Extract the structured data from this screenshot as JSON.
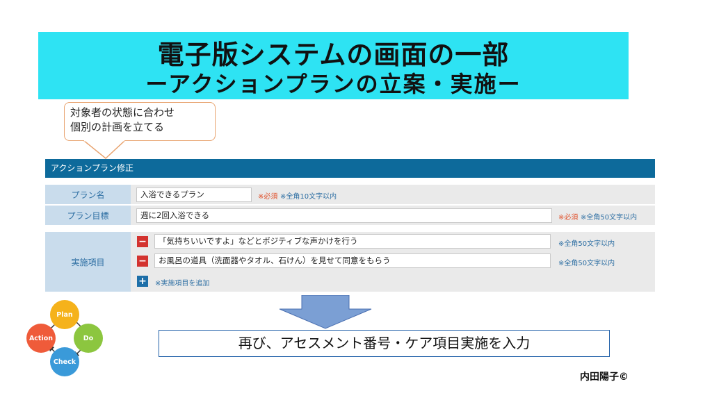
{
  "title": {
    "line1": "電子版システムの画面の一部",
    "line2": "ーアクションプランの立案・実施ー"
  },
  "callout": {
    "line1": "対象者の状態に合わせ",
    "line2": "個別の計画を立てる"
  },
  "form": {
    "header": "アクションプラン修正",
    "plan_name": {
      "label": "プラン名",
      "value": "入浴できるプラン",
      "required": "※必須",
      "limit": "※全角10文字以内"
    },
    "plan_goal": {
      "label": "プラン目標",
      "value": "週に2回入浴できる",
      "required": "※必須",
      "limit": "※全角50文字以内"
    },
    "items": {
      "label": "実施項目",
      "entries": [
        {
          "value": "「気持ちいいですよ」などとポジティブな声かけを行う",
          "limit": "※全角50文字以内"
        },
        {
          "value": "お風呂の道具（洗面器やタオル、石けん）を見せて同意をもらう",
          "limit": "※全角50文字以内"
        }
      ],
      "add_label": "※実施項目を追加"
    }
  },
  "pdca": {
    "plan": "Plan",
    "do": "Do",
    "check": "Check",
    "action": "Action",
    "colors": {
      "plan": "#f5b21b",
      "do": "#8cc63f",
      "check": "#3a9ad9",
      "action": "#ef5b3a"
    }
  },
  "result_box": "再び、アセスメント番号・ケア項目実施を入力",
  "credit": "内田陽子©",
  "colors": {
    "banner": "#2ee3f3",
    "form_header": "#0d6a9b",
    "label_bg": "#c9dcec",
    "required": "#e0502a"
  }
}
